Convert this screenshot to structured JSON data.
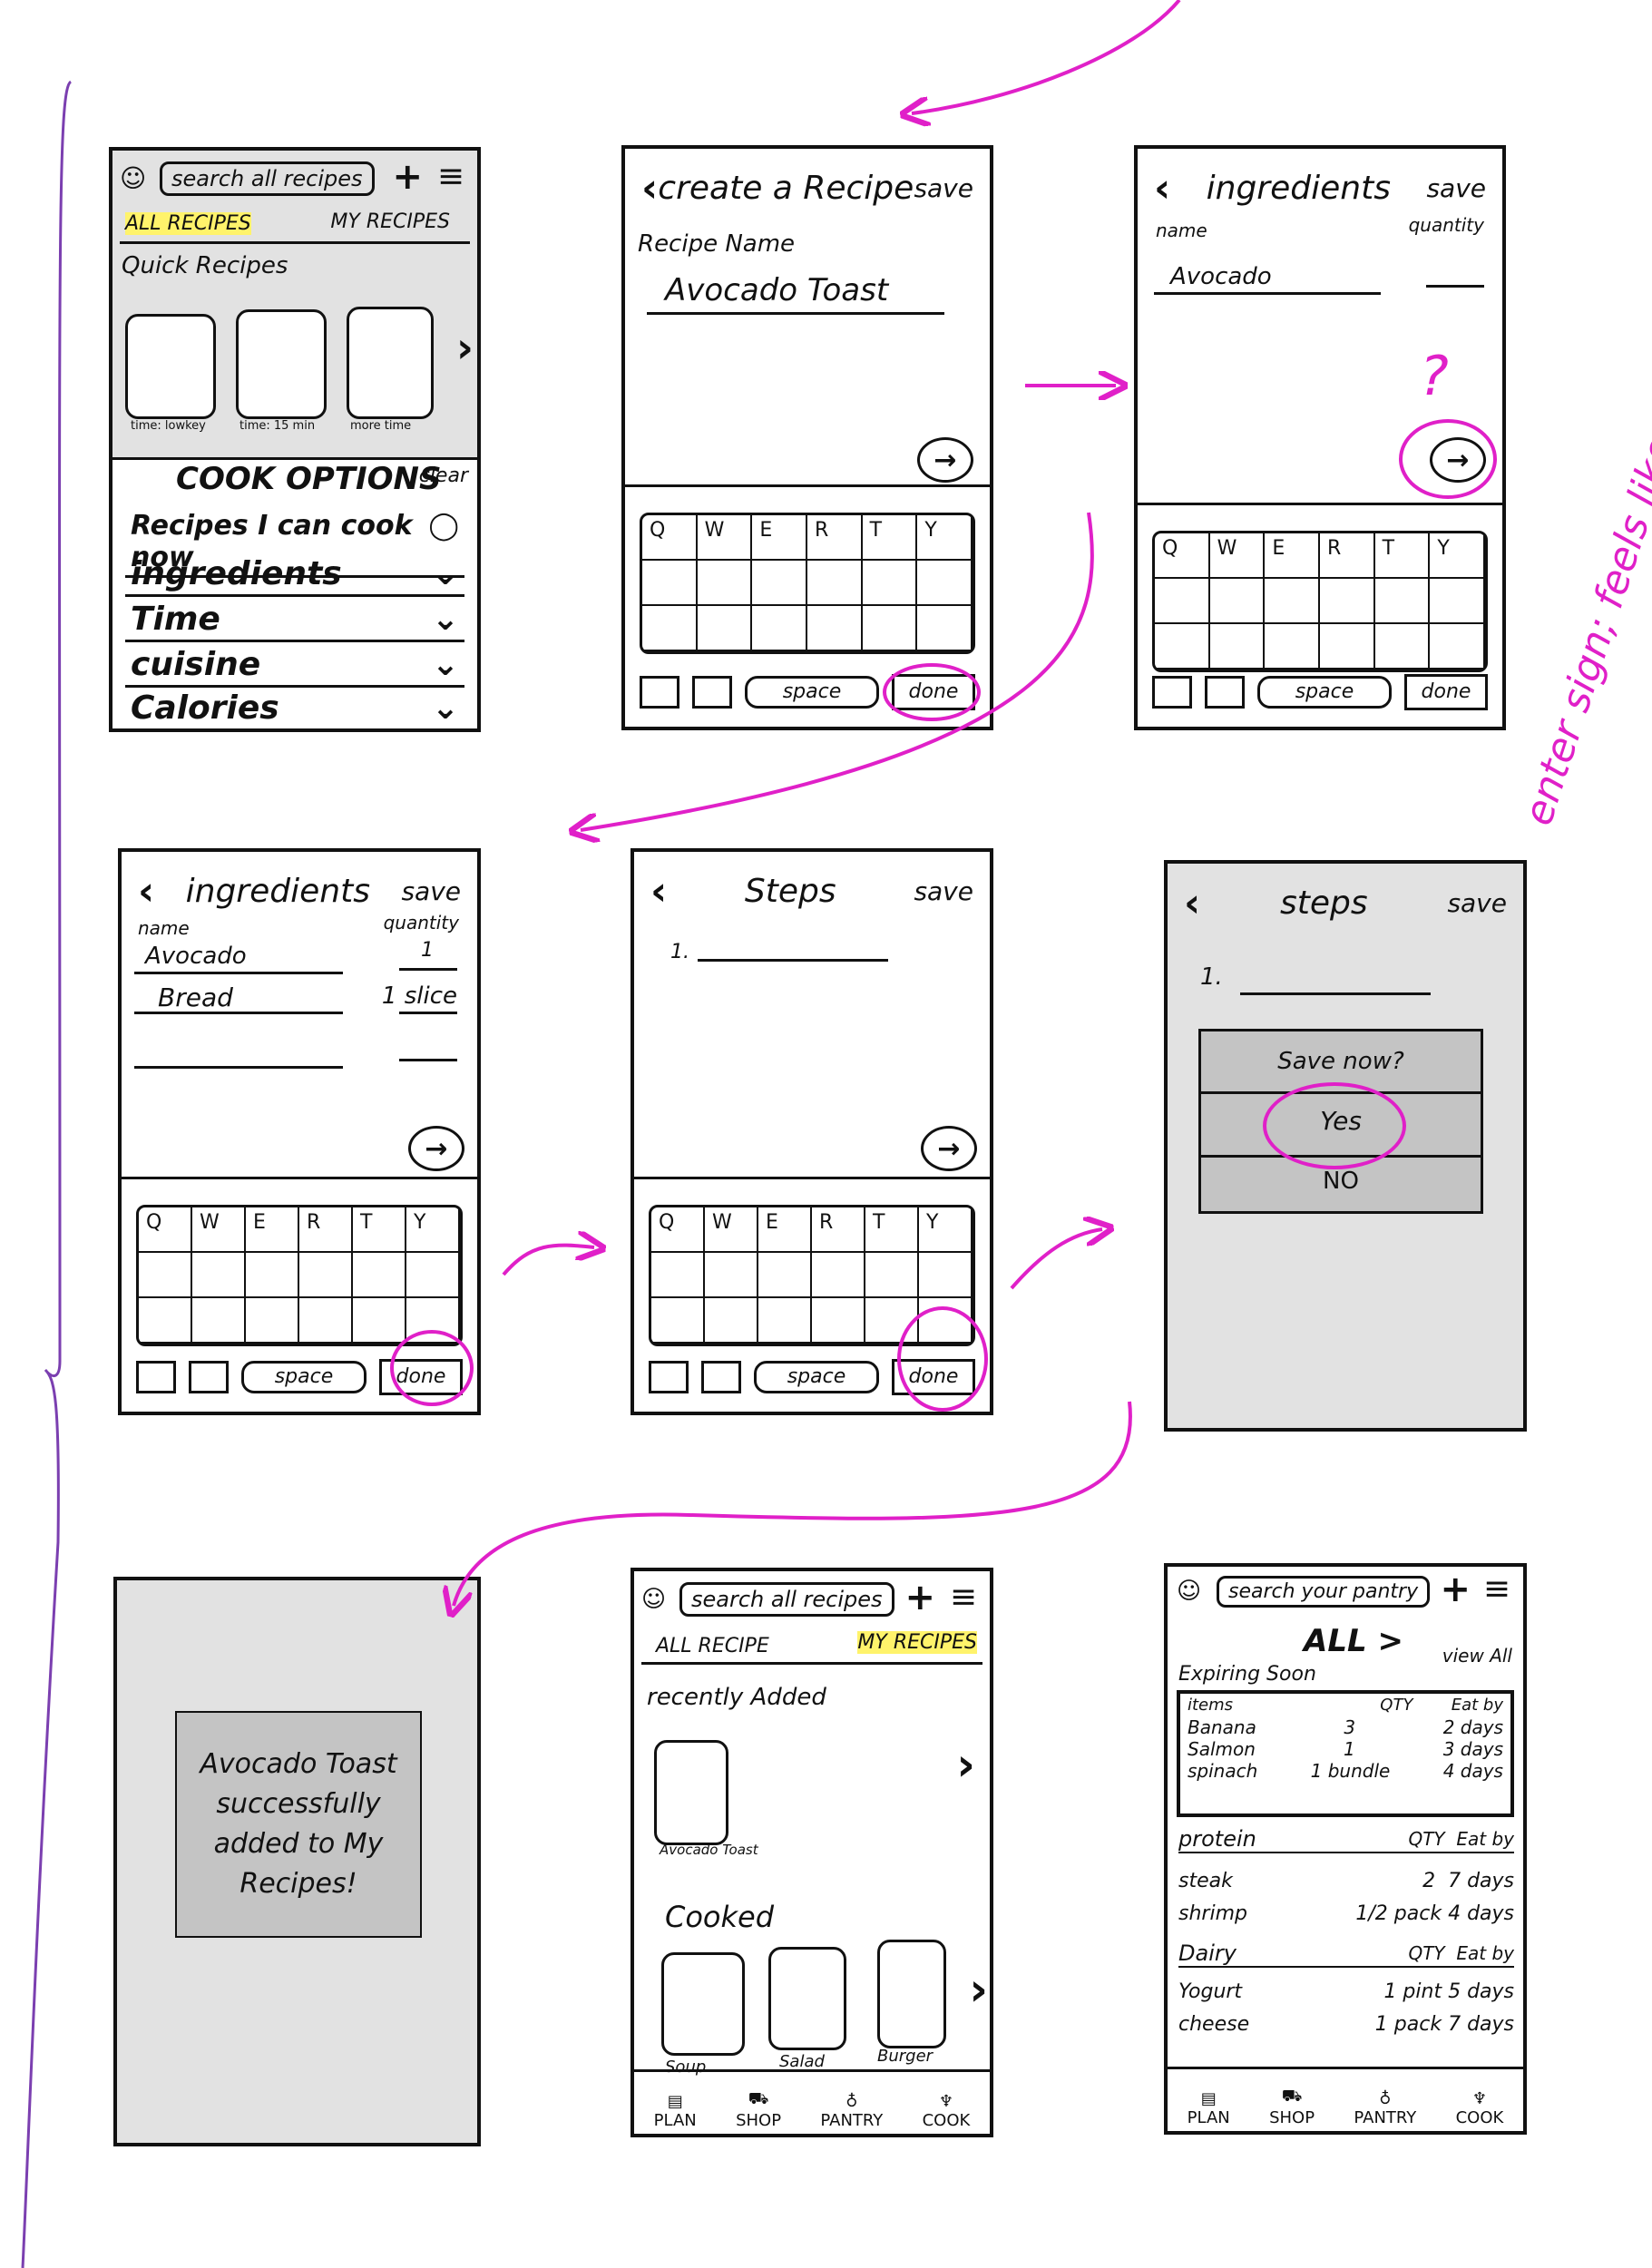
{
  "keyboard": {
    "keys": [
      "Q",
      "W",
      "E",
      "R",
      "T",
      "Y"
    ],
    "space": "space",
    "done": "done"
  },
  "screen1": {
    "search": "search all recipes",
    "tab_all": "ALL RECIPES",
    "tab_my": "MY RECIPES",
    "quick": "Quick Recipes",
    "tiles": [
      "time: lowkey",
      "time: 15 min",
      "more time"
    ],
    "cook_options": "COOK OPTIONS",
    "clear": "clear",
    "options": [
      "Recipes I can cook now",
      "ingredients",
      "Time",
      "cuisine",
      "Calories"
    ]
  },
  "screen2": {
    "title": "create a Recipe",
    "save": "save",
    "name_label": "Recipe Name",
    "name_value": "Avocado Toast"
  },
  "screen3": {
    "title": "ingredients",
    "save": "save",
    "col_name": "name",
    "col_qty": "quantity",
    "item1": "Avocado"
  },
  "annotation": {
    "question": "?",
    "note": "enter sign; feels like this is going to next step"
  },
  "screen4": {
    "title": "ingredients",
    "save": "save",
    "col_name": "name",
    "col_qty": "quantity",
    "items": [
      {
        "name": "Avocado",
        "qty": "1"
      },
      {
        "name": "Bread",
        "qty": "1 slice"
      }
    ]
  },
  "screen5": {
    "title": "Steps",
    "save": "save",
    "step": "1."
  },
  "screen6": {
    "title": "steps",
    "save": "save",
    "step": "1.",
    "prompt": "Save now?",
    "yes": "Yes",
    "no": "NO"
  },
  "screen7": {
    "message": "Avocado Toast successfully added to My Recipes!"
  },
  "screen8": {
    "search": "search all recipes",
    "tab_all": "ALL RECIPE",
    "tab_my": "MY RECIPES",
    "recent": "recently Added",
    "recent_item": "Avocado Toast",
    "cooked": "Cooked",
    "cooked_items": [
      "Soup",
      "Salad",
      "Burger"
    ]
  },
  "screen9": {
    "search": "search your pantry",
    "all": "ALL >",
    "view_all": "view All",
    "expiring": "Expiring Soon",
    "exp_head": [
      "items",
      "QTY",
      "Eat by"
    ],
    "exp_rows": [
      [
        "Banana",
        "3",
        "2 days"
      ],
      [
        "Salmon",
        "1",
        "3 days"
      ],
      [
        "spinach",
        "1 bundle",
        "4 days"
      ]
    ],
    "protein": "protein",
    "protein_head": [
      "QTY",
      "Eat by"
    ],
    "protein_rows": [
      [
        "steak",
        "2",
        "7 days"
      ],
      [
        "shrimp",
        "1/2 pack",
        "4 days"
      ]
    ],
    "dairy": "Dairy",
    "dairy_head": [
      "QTY",
      "Eat by"
    ],
    "dairy_rows": [
      [
        "Yogurt",
        "1 pint",
        "5 days"
      ],
      [
        "cheese",
        "1 pack",
        "7 days"
      ]
    ]
  },
  "nav": [
    "PLAN",
    "SHOP",
    "PANTRY",
    "COOK"
  ],
  "colors": {
    "ink": "#111111",
    "annotation": "#e020c8",
    "bracket": "#7b3fb0",
    "highlight": "#fff36b",
    "grey": "#e2e2e2"
  }
}
